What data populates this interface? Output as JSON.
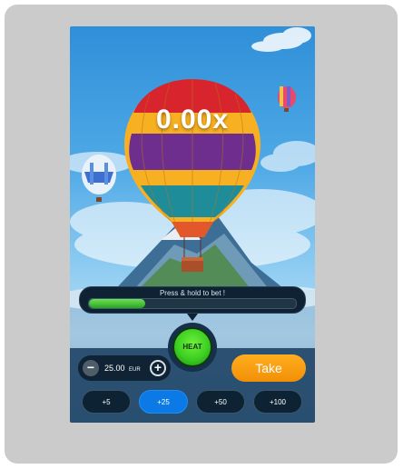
{
  "game": {
    "multiplier": "0.00x",
    "progress": {
      "label": "Press & hold to bet !",
      "fill_fraction": 0.27
    },
    "heat_button": {
      "label": "HEAT"
    },
    "bet": {
      "amount": "25.00",
      "currency": "EUR",
      "decrease_icon": "minus-icon",
      "increase_icon": "plus-icon"
    },
    "take_button": {
      "label": "Take"
    },
    "quick_bets": [
      {
        "label": "+5",
        "selected": false
      },
      {
        "label": "+25",
        "selected": true
      },
      {
        "label": "+50",
        "selected": false
      },
      {
        "label": "+100",
        "selected": false
      }
    ]
  },
  "colors": {
    "accent_orange": "#f7a21b",
    "heat_green": "#3ccf22",
    "selected_chip_blue": "#0b7ae6",
    "progress_green": "#4cc83a"
  }
}
